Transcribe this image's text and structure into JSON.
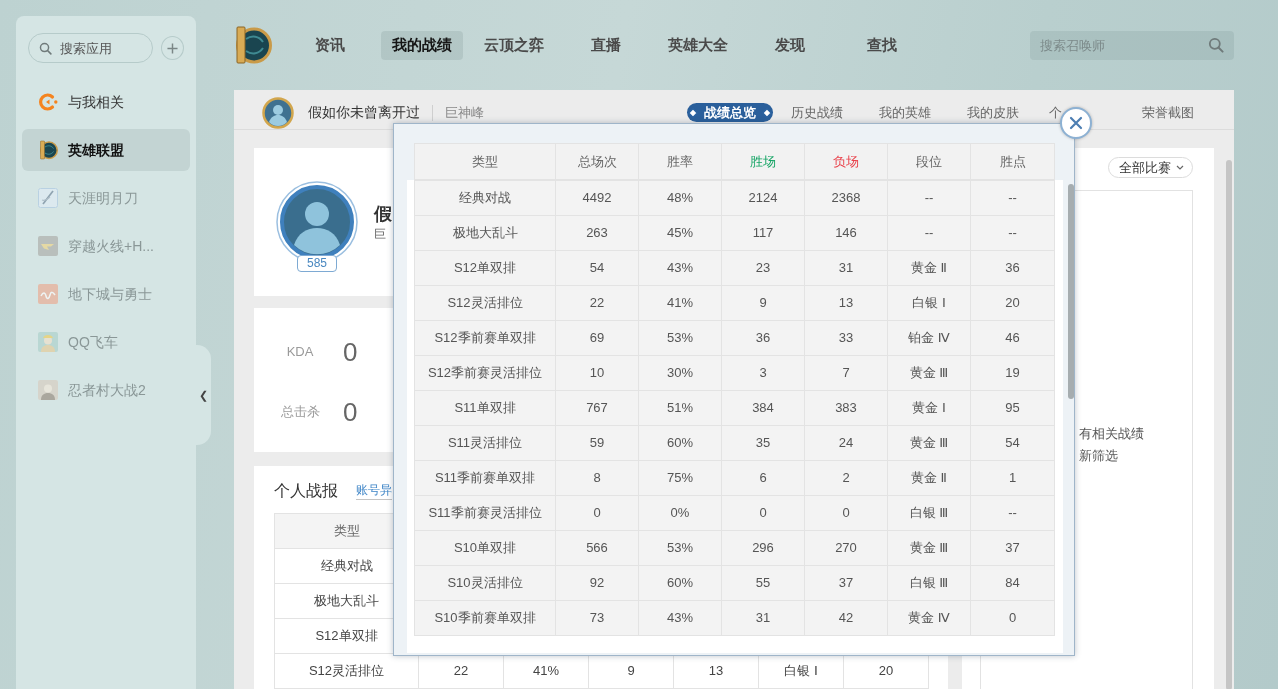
{
  "sidebar": {
    "search": {
      "placeholder": "搜索应用"
    },
    "items": [
      {
        "label": "与我相关",
        "selected": false,
        "disabled": false
      },
      {
        "label": "英雄联盟",
        "selected": true,
        "disabled": false
      },
      {
        "label": "天涯明月刀",
        "selected": false,
        "disabled": true
      },
      {
        "label": "穿越火线+H...",
        "selected": false,
        "disabled": true
      },
      {
        "label": "地下城与勇士",
        "selected": false,
        "disabled": true
      },
      {
        "label": "QQ飞车",
        "selected": false,
        "disabled": true
      },
      {
        "label": "忍者村大战2",
        "selected": false,
        "disabled": true
      }
    ],
    "collapse_toggle": "❮"
  },
  "topbar": {
    "nav": [
      {
        "label": "资讯",
        "selected": false
      },
      {
        "label": "我的战绩",
        "selected": true
      },
      {
        "label": "云顶之弈",
        "selected": false
      },
      {
        "label": "直播",
        "selected": false
      },
      {
        "label": "英雄大全",
        "selected": false
      },
      {
        "label": "发现",
        "selected": false
      },
      {
        "label": "查找",
        "selected": false
      }
    ],
    "search": {
      "placeholder": "搜索召唤师"
    }
  },
  "summoner_bar": {
    "name": "假如你未曾离开过",
    "server": "巨神峰",
    "tabs": [
      {
        "label": "战绩总览",
        "selected": true
      },
      {
        "label": "历史战绩",
        "selected": false
      },
      {
        "label": "我的英雄",
        "selected": false
      },
      {
        "label": "我的皮肤",
        "selected": false
      },
      {
        "label": "个",
        "selected": false
      },
      {
        "label": "荣誉截图",
        "selected": false
      }
    ]
  },
  "profile": {
    "name": "假",
    "server": "巨",
    "level": "585"
  },
  "stats": [
    {
      "label": "KDA",
      "value": "0"
    },
    {
      "label": "总击杀",
      "value": "0"
    }
  ],
  "personal_report": {
    "title": "个人战报",
    "link": "账号异",
    "columns": [
      "类型"
    ],
    "rows": [
      [
        "经典对战"
      ],
      [
        "极地大乱斗"
      ],
      [
        "S12单双排"
      ],
      [
        "S12灵活排位",
        "22",
        "41%",
        "9",
        "13",
        "白银 Ⅰ",
        "20"
      ]
    ]
  },
  "match_panel": {
    "filter": "全部比赛",
    "message_lines": [
      "有相关战绩",
      "新筛选"
    ]
  },
  "stats_popup": {
    "columns": [
      {
        "label": "类型",
        "kind": "plain"
      },
      {
        "label": "总场次",
        "kind": "plain"
      },
      {
        "label": "胜率",
        "kind": "plain"
      },
      {
        "label": "胜场",
        "kind": "win"
      },
      {
        "label": "负场",
        "kind": "loss"
      },
      {
        "label": "段位",
        "kind": "plain"
      },
      {
        "label": "胜点",
        "kind": "plain"
      }
    ],
    "rows": [
      [
        "经典对战",
        "4492",
        "48%",
        "2124",
        "2368",
        "--",
        "--"
      ],
      [
        "极地大乱斗",
        "263",
        "45%",
        "117",
        "146",
        "--",
        "--"
      ],
      [
        "S12单双排",
        "54",
        "43%",
        "23",
        "31",
        "黄金 Ⅱ",
        "36"
      ],
      [
        "S12灵活排位",
        "22",
        "41%",
        "9",
        "13",
        "白银 Ⅰ",
        "20"
      ],
      [
        "S12季前赛单双排",
        "69",
        "53%",
        "36",
        "33",
        "铂金 Ⅳ",
        "46"
      ],
      [
        "S12季前赛灵活排位",
        "10",
        "30%",
        "3",
        "7",
        "黄金 Ⅲ",
        "19"
      ],
      [
        "S11单双排",
        "767",
        "51%",
        "384",
        "383",
        "黄金 Ⅰ",
        "95"
      ],
      [
        "S11灵活排位",
        "59",
        "60%",
        "35",
        "24",
        "黄金 Ⅲ",
        "54"
      ],
      [
        "S11季前赛单双排",
        "8",
        "75%",
        "6",
        "2",
        "黄金 Ⅱ",
        "1"
      ],
      [
        "S11季前赛灵活排位",
        "0",
        "0%",
        "0",
        "0",
        "白银 Ⅲ",
        "--"
      ],
      [
        "S10单双排",
        "566",
        "53%",
        "296",
        "270",
        "黄金 Ⅲ",
        "37"
      ],
      [
        "S10灵活排位",
        "92",
        "60%",
        "55",
        "37",
        "白银 Ⅲ",
        "84"
      ],
      [
        "S10季前赛单双排",
        "73",
        "43%",
        "31",
        "42",
        "黄金 Ⅳ",
        "0"
      ]
    ]
  }
}
